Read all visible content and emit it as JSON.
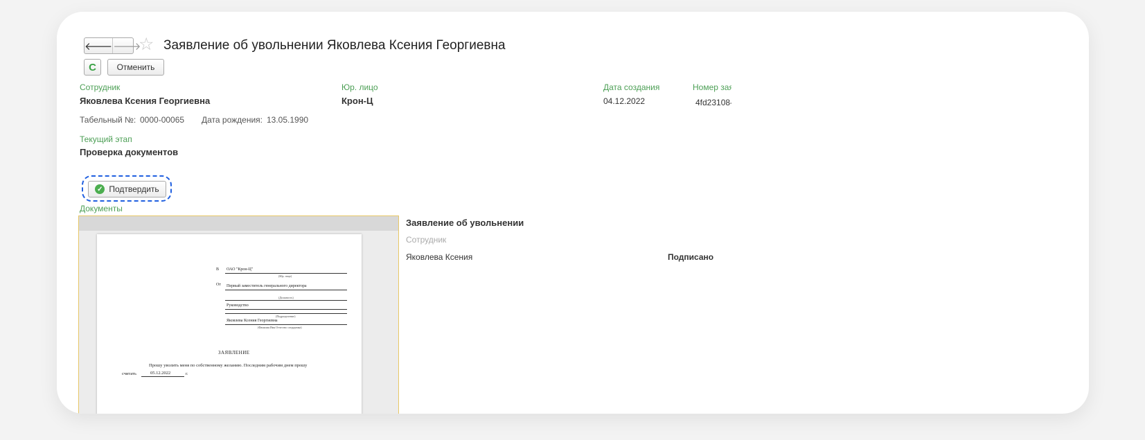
{
  "header": {
    "title": "Заявление об увольнении Яковлева Ксения Георгиевна",
    "back_glyph": "🡐",
    "forward_glyph": "🡒",
    "star_glyph": "☆",
    "refresh_glyph": "C",
    "cancel_label": "Отменить"
  },
  "fields": {
    "employee_label": "Сотрудник",
    "employee_value": "Яковлева Ксения Георгиевна",
    "legal_entity_label": "Юр. лицо",
    "legal_entity_value": "Крон-Ц",
    "created_label": "Дата создания",
    "created_value": "04.12.2022",
    "number_label": "Номер зая",
    "number_value": "4fd23108-",
    "tab_number_label": "Табельный №:",
    "tab_number_value": "0000-00065",
    "birth_label": "Дата рождения:",
    "birth_value": "13.05.1990",
    "stage_label": "Текущий этап",
    "stage_value": "Проверка документов"
  },
  "actions": {
    "confirm_label": "Подтвердить",
    "confirm_glyph": "✓"
  },
  "documents": {
    "section_label": "Документы",
    "doc_title": "Заявление об увольнении",
    "employee_label": "Сотрудник",
    "employee_value": "Яковлева Ксения",
    "status_value": "Подписано"
  },
  "preview_doc": {
    "to_prefix": "В",
    "to_value": "ОАО \"Крон-Ц\"",
    "to_caption": "(Юр. лицо)",
    "from_prefix": "От",
    "position_value": "Первый заместитель генерального директора",
    "position_caption": "(Должность)",
    "department_value": "Руководство",
    "department_caption": "(Подразделение)",
    "name_value": "Яковлева Ксения Георгиевна",
    "name_caption": "(Фамилия Имя Отчество сотрудника)",
    "heading": "ЗАЯВЛЕНИЕ",
    "body_line1": "Прошу уволить меня по собственному желанию. Последним рабочим днем прошу",
    "body_prefix": "считать",
    "body_date": "05.12.2022",
    "body_suffix": "г."
  }
}
